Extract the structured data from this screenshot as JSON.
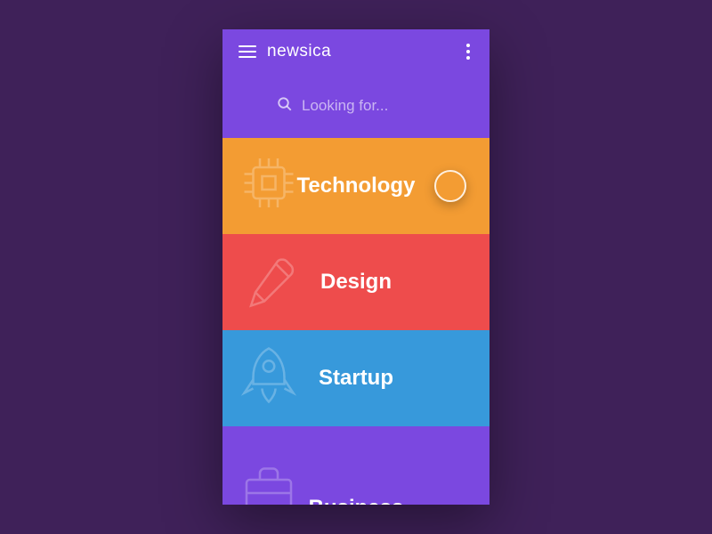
{
  "header": {
    "title": "newsica"
  },
  "search": {
    "placeholder": "Looking for..."
  },
  "categories": [
    {
      "label": "Technology",
      "icon": "chip-icon",
      "color": "#f39c33",
      "selected": true
    },
    {
      "label": "Design",
      "icon": "pencil-icon",
      "color": "#ee4c4c",
      "selected": false
    },
    {
      "label": "Startup",
      "icon": "rocket-icon",
      "color": "#3799db",
      "selected": false
    },
    {
      "label": "Business",
      "icon": "briefcase-icon",
      "color": "#7b48e0",
      "selected": false
    }
  ]
}
